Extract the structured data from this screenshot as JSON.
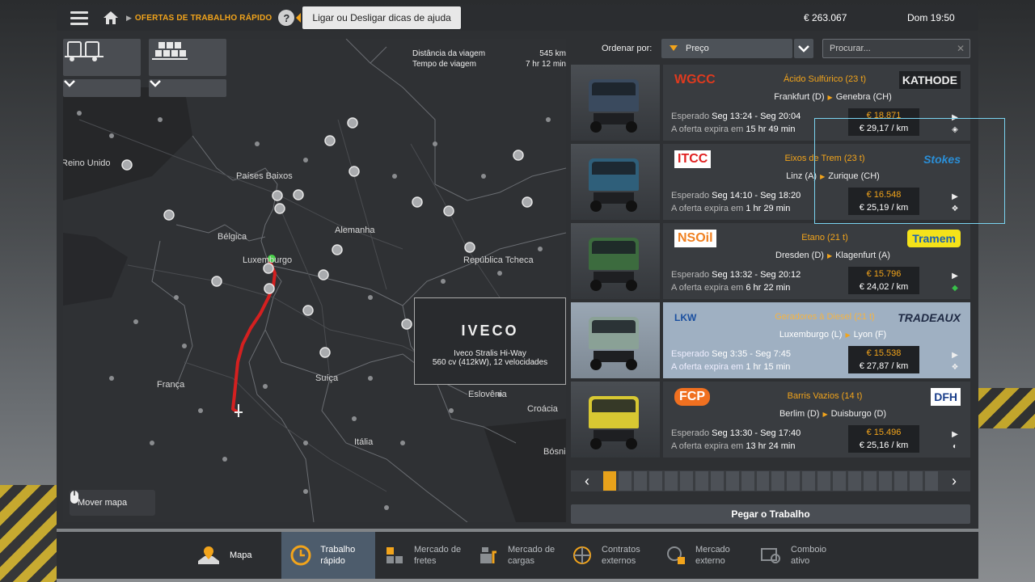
{
  "topbar": {
    "breadcrumb": "OFERTAS DE TRABALHO RÁPIDO",
    "help_tooltip": "Ligar ou Desligar dicas de ajuda",
    "money": "€ 263.067",
    "clock": "Dom 19:50"
  },
  "map": {
    "trip_distance_label": "Distância da viagem",
    "trip_distance": "545 km",
    "trip_time_label": "Tempo de viagem",
    "trip_time": "7 hr 12 min",
    "labels": {
      "reino_unido": "Reino Unido",
      "paises_baixos": "Países Baixos",
      "belgica": "Bélgica",
      "alemanha": "Alemanha",
      "luxemburgo": "Luxemburgo",
      "republica_tcheca": "República Tcheca",
      "franca": "França",
      "suica": "Suíça",
      "eslovenia": "Eslovênia",
      "croacia": "Croácia",
      "italia": "Itália",
      "bosnia": "Bósni"
    },
    "truck_popup": {
      "brand": "IVECO",
      "model": "Iveco Stralis Hi-Way",
      "spec": "560 cv (412kW), 12 velocidades"
    },
    "move_map_label": "Mover mapa"
  },
  "sort": {
    "label": "Ordenar por:",
    "selected": "Preço",
    "search_placeholder": "Procurar..."
  },
  "jobs": [
    {
      "company": "WGCC",
      "cargo": "Ácido Sulfúrico (23 t)",
      "client": "KATHODE",
      "from": "Frankfurt (D)",
      "to": "Genebra (CH)",
      "expected_label": "Esperado",
      "expected": "Seg 13:24 - Seg 20:04",
      "expires_label": "A oferta expira em",
      "expires": "15 hr 49 min",
      "price": "€ 18.871",
      "per_km": "€ 29,17 / km",
      "truck_color": "#3a4a5e"
    },
    {
      "company": "ITCC",
      "cargo": "Eixos de Trem (23 t)",
      "client": "Stokes",
      "from": "Linz (A)",
      "to": "Zurique (CH)",
      "expected_label": "Esperado",
      "expected": "Seg 14:10 - Seg 18:20",
      "expires_label": "A oferta expira em",
      "expires": "1 hr 29 min",
      "price": "€ 16.548",
      "per_km": "€ 25,19 / km",
      "truck_color": "#2f5f7a"
    },
    {
      "company": "NSOil",
      "cargo": "Etano (21 t)",
      "client": "Tramem",
      "from": "Dresden (D)",
      "to": "Klagenfurt (A)",
      "expected_label": "Esperado",
      "expected": "Seg 13:32 - Seg 20:12",
      "expires_label": "A oferta expira em",
      "expires": "6 hr 22 min",
      "price": "€ 15.796",
      "per_km": "€ 24,02 / km",
      "truck_color": "#3c6b3e"
    },
    {
      "company": "LKW",
      "cargo": "Geradores à Diesel (21 t)",
      "client": "TRADEAUX",
      "from": "Luxemburgo (L)",
      "to": "Lyon (F)",
      "expected_label": "Esperado",
      "expected": "Seg 3:35 - Seg 7:45",
      "expires_label": "A oferta expira em",
      "expires": "1 hr 15 min",
      "price": "€ 15.538",
      "per_km": "€ 27,87 / km",
      "truck_color": "#8aa196"
    },
    {
      "company": "FCP",
      "cargo": "Barris Vazios (14 t)",
      "client": "DFH",
      "from": "Berlim (D)",
      "to": "Duisburgo (D)",
      "expected_label": "Esperado",
      "expected": "Seg 13:30 - Seg 17:40",
      "expires_label": "A oferta expira em",
      "expires": "13 hr 24 min",
      "price": "€ 15.496",
      "per_km": "€ 25,16 / km",
      "truck_color": "#d8c832"
    }
  ],
  "pager": {
    "total": 22,
    "active": 0
  },
  "take_job_label": "Pegar o Trabalho",
  "bottombar": [
    {
      "label": "Mapa",
      "icon": "map-icon"
    },
    {
      "label": "Trabalho rápido",
      "icon": "quick-job-icon"
    },
    {
      "label": "Mercado de fretes",
      "icon": "freight-market-icon"
    },
    {
      "label": "Mercado de cargas",
      "icon": "cargo-market-icon"
    },
    {
      "label": "Contratos externos",
      "icon": "external-contracts-icon"
    },
    {
      "label": "Mercado externo",
      "icon": "external-market-icon"
    },
    {
      "label": "Comboio ativo",
      "icon": "convoy-icon"
    }
  ],
  "colors": {
    "accent": "#f2a41b",
    "selected_row": "#9fb0c2",
    "route": "#d42020"
  }
}
